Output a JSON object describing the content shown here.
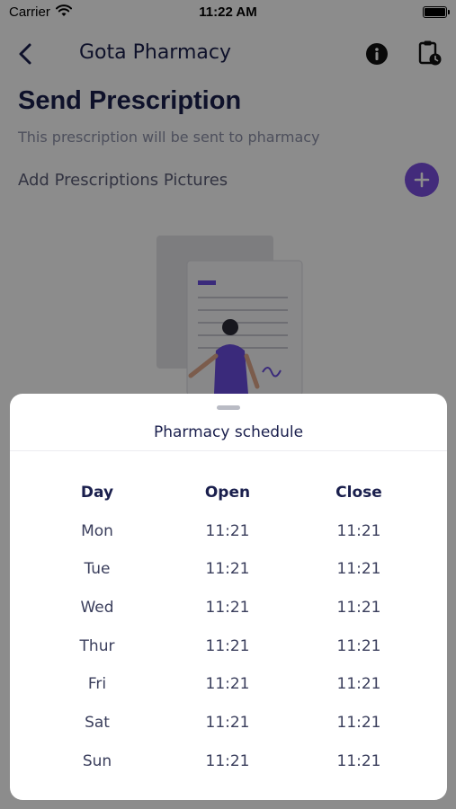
{
  "status_bar": {
    "carrier": "Carrier",
    "time": "11:22 AM"
  },
  "navbar": {
    "title": "Gota Pharmacy",
    "back_icon": "chevron-left-icon",
    "info_icon": "info-icon",
    "schedule_icon": "clipboard-clock-icon"
  },
  "page": {
    "title": "Send Prescription",
    "subtitle": "This prescription will be sent to pharmacy",
    "add_label": "Add Prescriptions Pictures",
    "add_icon": "plus-icon",
    "accent_color": "#7b4fe0"
  },
  "sheet": {
    "title": "Pharmacy schedule",
    "headers": [
      "Day",
      "Open",
      "Close"
    ],
    "rows": [
      [
        "Mon",
        "11:21",
        "11:21"
      ],
      [
        "Tue",
        "11:21",
        "11:21"
      ],
      [
        "Wed",
        "11:21",
        "11:21"
      ],
      [
        "Thur",
        "11:21",
        "11:21"
      ],
      [
        "Fri",
        "11:21",
        "11:21"
      ],
      [
        "Sat",
        "11:21",
        "11:21"
      ],
      [
        "Sun",
        "11:21",
        "11:21"
      ]
    ]
  }
}
